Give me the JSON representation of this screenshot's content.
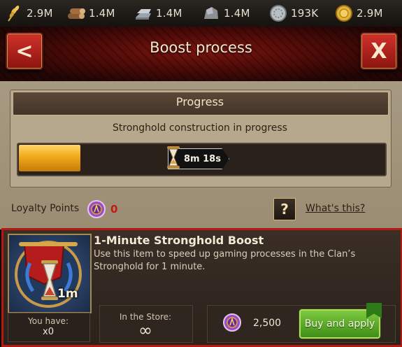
{
  "resources": [
    {
      "icon": "wheat-icon",
      "value": "2.9M"
    },
    {
      "icon": "wood-logs-icon",
      "value": "1.4M"
    },
    {
      "icon": "iron-ingots-icon",
      "value": "1.4M"
    },
    {
      "icon": "stone-icon",
      "value": "1.4M"
    },
    {
      "icon": "silver-coin-icon",
      "value": "193K"
    },
    {
      "icon": "gold-coin-icon",
      "value": "2.9M"
    }
  ],
  "header": {
    "title": "Boost process",
    "back_label": "<",
    "close_label": "X"
  },
  "progress": {
    "title": "Progress",
    "subtitle": "Stronghold construction in progress",
    "fraction": 0.17,
    "timer": "8m 18s",
    "bar_color": "#f0a919"
  },
  "loyalty": {
    "label": "Loyalty Points",
    "value": "0",
    "help_label": "?",
    "link": "What's this?"
  },
  "item": {
    "name": "1-Minute Stronghold Boost",
    "description": "Use this item to speed up gaming processes in the Clan’s Stronghold for 1 minute.",
    "duration": "1m",
    "have_label": "You have:",
    "have_value": "x0",
    "store_label": "In the Store:",
    "store_value": "∞",
    "price": "2,500",
    "buy_label": "Buy and apply"
  },
  "colors": {
    "accent_red": "#b51a12",
    "button_green": "#5aa82a",
    "loyalty_red": "#c21a10"
  }
}
